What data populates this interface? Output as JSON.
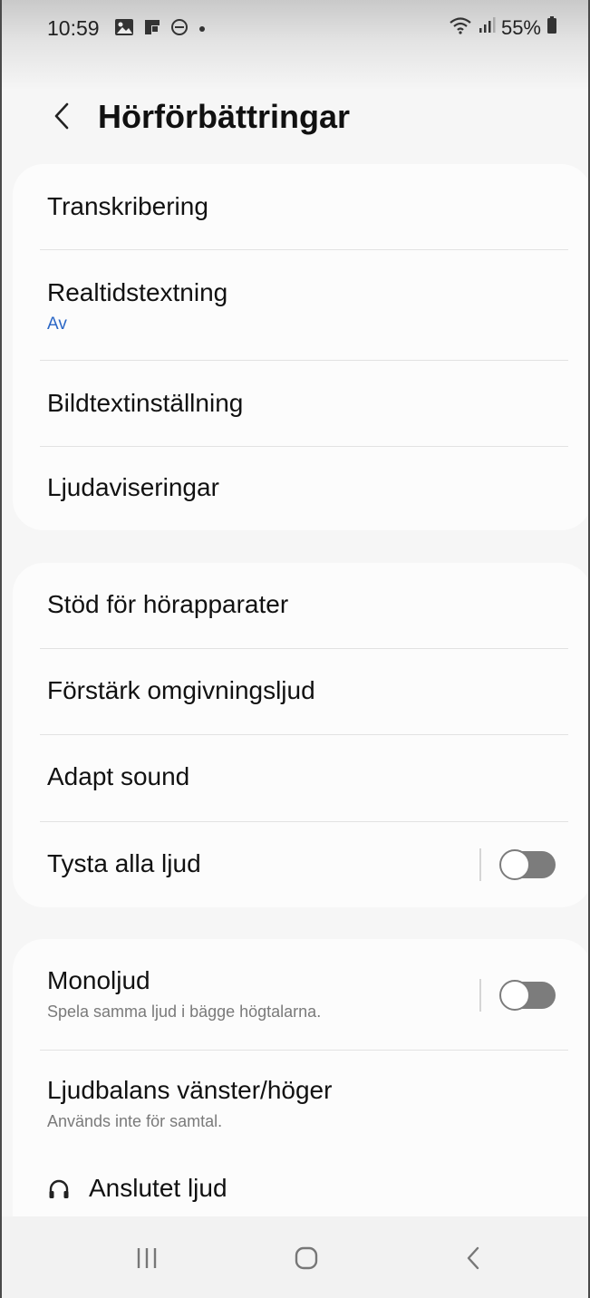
{
  "status_bar": {
    "time": "10:59",
    "battery": "55%",
    "icons_left": [
      "gallery-icon",
      "flipboard-icon",
      "do-not-disturb-icon",
      "dot-icon"
    ],
    "icons_right": [
      "wifi-icon",
      "signal-icon",
      "battery-icon"
    ]
  },
  "header": {
    "title": "Hörförbättringar",
    "back_icon": "chevron-left-icon"
  },
  "sections": [
    {
      "items": [
        {
          "title": "Transkribering"
        },
        {
          "title": "Realtidstextning",
          "subtitle": "Av"
        },
        {
          "title": "Bildtextinställning"
        },
        {
          "title": "Ljudaviseringar"
        }
      ]
    },
    {
      "items": [
        {
          "title": "Stöd för hörapparater"
        },
        {
          "title": "Förstärk omgivningsljud"
        },
        {
          "title": "Adapt sound"
        },
        {
          "title": "Tysta alla ljud",
          "toggle": false
        }
      ]
    },
    {
      "items": [
        {
          "title": "Monoljud",
          "subtitle": "Spela samma ljud i bägge högtalarna.",
          "toggle": false
        },
        {
          "title": "Ljudbalans vänster/höger",
          "subtitle": "Används inte för samtal."
        },
        {
          "title": "Anslutet ljud",
          "icon": "headphones-icon"
        }
      ]
    }
  ],
  "nav_bar": {
    "buttons": [
      "recents-icon",
      "home-icon",
      "back-icon"
    ]
  },
  "colors": {
    "accent": "#2b67c6",
    "toggle_off": "#7c7c7c",
    "background": "#f6f6f6",
    "card": "#fcfcfc"
  }
}
